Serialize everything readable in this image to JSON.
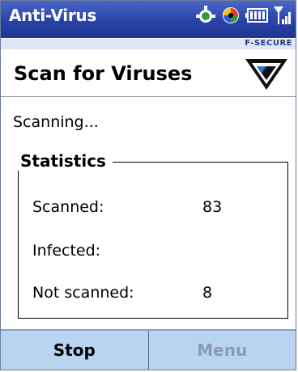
{
  "titlebar": {
    "title": "Anti-Virus",
    "icons": [
      "sync-icon",
      "messaging-icon",
      "battery-icon",
      "signal-icon"
    ]
  },
  "brand": {
    "name": "F-SECURE"
  },
  "header": {
    "title": "Scan for Viruses"
  },
  "status": {
    "text": "Scanning..."
  },
  "statistics": {
    "legend": "Statistics",
    "rows": [
      {
        "label": "Scanned:",
        "value": "83"
      },
      {
        "label": "Infected:",
        "value": ""
      },
      {
        "label": "Not scanned:",
        "value": "8"
      }
    ]
  },
  "softkeys": {
    "left": "Stop",
    "right": "Menu"
  },
  "colors": {
    "titlebar": "#2842a6",
    "softbar": "#b9d4ef",
    "brand": "#1d3a8a"
  }
}
